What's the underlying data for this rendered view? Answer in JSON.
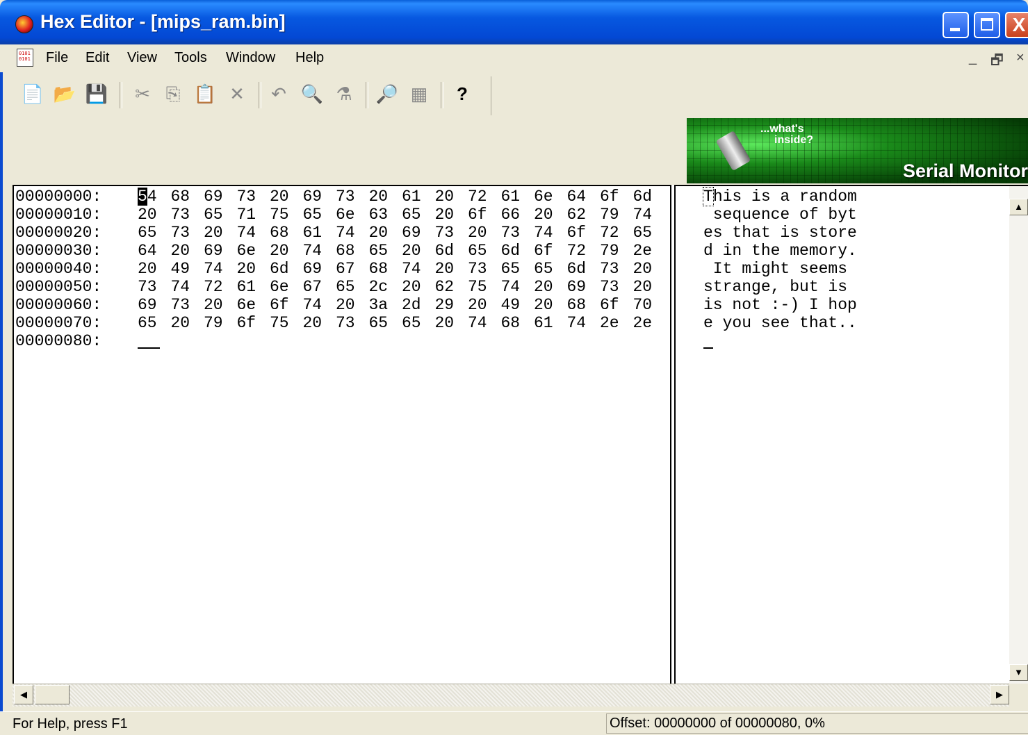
{
  "window": {
    "title": "Hex Editor - [mips_ram.bin]",
    "controls": {
      "minimize": "_",
      "maximize": "□",
      "close": "X"
    }
  },
  "menu": {
    "items": [
      "File",
      "Edit",
      "View",
      "Tools",
      "Window",
      "Help"
    ],
    "mdi_controls": {
      "minimize": "_",
      "restore": "🗗",
      "close": "×"
    }
  },
  "toolbar": {
    "buttons": [
      "new-file-icon",
      "open-folder-icon",
      "save-icon",
      "cut-icon",
      "copy-icon",
      "paste-icon",
      "delete-icon",
      "undo-icon",
      "find-icon",
      "replace-icon",
      "serial-read-icon",
      "serial-write-icon",
      "help-icon"
    ]
  },
  "banner": {
    "tagline_1": "...what's",
    "tagline_2": "inside?",
    "title": "Serial Monitor"
  },
  "hex": {
    "rows": [
      {
        "offset": "00000000:",
        "bytes": [
          "54",
          "68",
          "69",
          "73",
          "20",
          "69",
          "73",
          "20",
          "61",
          "20",
          "72",
          "61",
          "6e",
          "64",
          "6f",
          "6d"
        ],
        "ascii": "This is a random"
      },
      {
        "offset": "00000010:",
        "bytes": [
          "20",
          "73",
          "65",
          "71",
          "75",
          "65",
          "6e",
          "63",
          "65",
          "20",
          "6f",
          "66",
          "20",
          "62",
          "79",
          "74"
        ],
        "ascii": " sequence of byt"
      },
      {
        "offset": "00000020:",
        "bytes": [
          "65",
          "73",
          "20",
          "74",
          "68",
          "61",
          "74",
          "20",
          "69",
          "73",
          "20",
          "73",
          "74",
          "6f",
          "72",
          "65"
        ],
        "ascii": "es that is store"
      },
      {
        "offset": "00000030:",
        "bytes": [
          "64",
          "20",
          "69",
          "6e",
          "20",
          "74",
          "68",
          "65",
          "20",
          "6d",
          "65",
          "6d",
          "6f",
          "72",
          "79",
          "2e"
        ],
        "ascii": "d in the memory."
      },
      {
        "offset": "00000040:",
        "bytes": [
          "20",
          "49",
          "74",
          "20",
          "6d",
          "69",
          "67",
          "68",
          "74",
          "20",
          "73",
          "65",
          "65",
          "6d",
          "73",
          "20"
        ],
        "ascii": " It might seems "
      },
      {
        "offset": "00000050:",
        "bytes": [
          "73",
          "74",
          "72",
          "61",
          "6e",
          "67",
          "65",
          "2c",
          "20",
          "62",
          "75",
          "74",
          "20",
          "69",
          "73",
          "20"
        ],
        "ascii": "strange, but is "
      },
      {
        "offset": "00000060:",
        "bytes": [
          "69",
          "73",
          "20",
          "6e",
          "6f",
          "74",
          "20",
          "3a",
          "2d",
          "29",
          "20",
          "49",
          "20",
          "68",
          "6f",
          "70"
        ],
        "ascii": "is not :-) I hop"
      },
      {
        "offset": "00000070:",
        "bytes": [
          "65",
          "20",
          "79",
          "6f",
          "75",
          "20",
          "73",
          "65",
          "65",
          "20",
          "74",
          "68",
          "61",
          "74",
          "2e",
          "2e"
        ],
        "ascii": "e you see that.."
      }
    ],
    "last_offset": "00000080:"
  },
  "status": {
    "help": "For Help, press F1",
    "offset": "Offset: 00000000 of 00000080, 0%"
  }
}
